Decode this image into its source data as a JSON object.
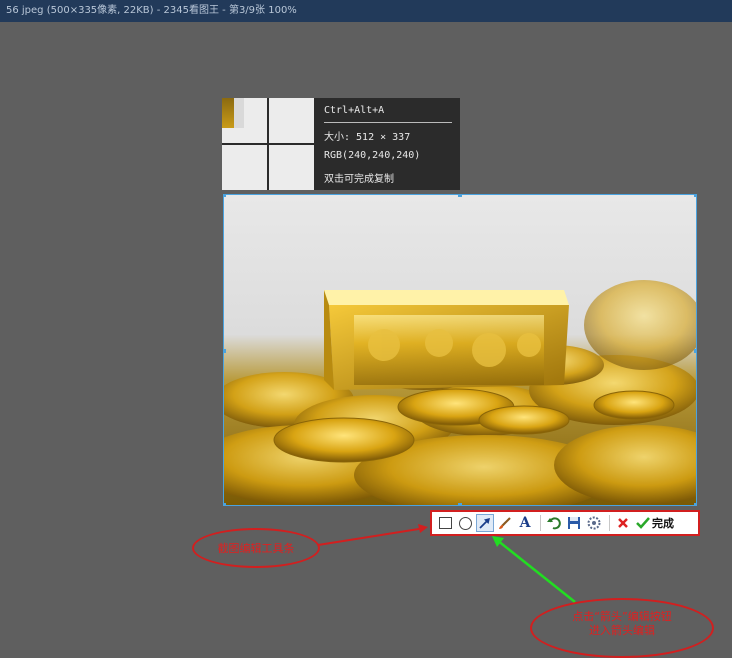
{
  "window": {
    "title": "56 jpeg (500×335像素, 22KB) - 2345看图王 - 第3/9张 100%"
  },
  "info_panel": {
    "hotkey": "Ctrl+Alt+A",
    "size": "大小: 512 × 337",
    "rgb": "RGB(240,240,240)",
    "hint": "双击可完成复制"
  },
  "toolbar": {
    "tools": [
      {
        "name": "rectangle-tool",
        "icon": "square-icon"
      },
      {
        "name": "ellipse-tool",
        "icon": "circle-icon"
      },
      {
        "name": "arrow-tool",
        "icon": "arrow-icon",
        "active": true
      },
      {
        "name": "brush-tool",
        "icon": "brush-icon"
      },
      {
        "name": "text-tool",
        "icon": "text-icon",
        "label": "A"
      },
      {
        "name": "undo-tool",
        "icon": "undo-icon"
      },
      {
        "name": "save-tool",
        "icon": "save-icon"
      },
      {
        "name": "settings-tool",
        "icon": "gear-icon"
      },
      {
        "name": "cancel-tool",
        "icon": "close-icon"
      }
    ],
    "done_label": "完成"
  },
  "annotations": {
    "toolbar_label": "截图编辑工具条",
    "arrow_tip_line1": "点击“箭头”编辑按钮",
    "arrow_tip_line2": "进入箭头编辑"
  },
  "colors": {
    "background": "#5f5f5f",
    "titlebar": "#223a5a",
    "selection_border": "#4aa3e0",
    "annotation_red": "#d21f1f",
    "annotation_green": "#22dd22"
  }
}
